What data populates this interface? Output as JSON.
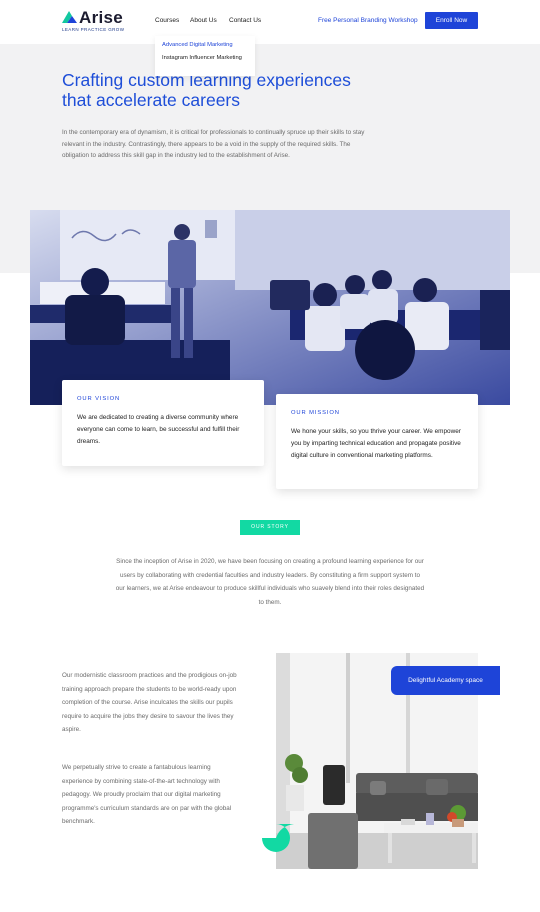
{
  "header": {
    "logo_word": "Arise",
    "logo_tagline": "LEARN PRACTICE GROW",
    "nav": [
      "Courses",
      "About Us",
      "Contact Us"
    ],
    "workshop_link": "Free Personal Branding Workshop",
    "enroll_label": "Enroll Now"
  },
  "dropdown": {
    "items": [
      "Advanced Digital Marketing",
      "Instagram Influencer Marketing"
    ]
  },
  "hero": {
    "title": "Crafting custom learning experiences that accelerate careers",
    "text": "In the contemporary era of dynamism, it is critical for professionals to continually spruce up their skills to stay relevant in the industry. Contrastingly, there appears to be a void in the supply of the required skills. The obligation to address this skill gap in the industry led to the establishment of Arise."
  },
  "vision": {
    "label": "OUR VISION",
    "text": "We are dedicated to creating a diverse community where everyone can come to learn, be successful and fulfill their dreams."
  },
  "mission": {
    "label": "OUR MISSION",
    "text": "We hone your skills, so you thrive your career. We empower you by imparting technical education and propagate positive digital culture in conventional marketing platforms."
  },
  "story": {
    "badge": "OUR STORY",
    "text": "Since the inception of Arise in 2020, we have been focusing on creating a profound learning experience for our users by collaborating with credential faculties and industry leaders. By constituting a firm support system to our learners, we at Arise endeavour to produce skillful individuals who suavely blend into their roles designated to them."
  },
  "about": {
    "para1": "Our modernistic classroom practices and the prodigious on-job training approach prepare the students to be world-ready upon completion of the course. Arise inculcates the skills our pupils require to acquire the jobs they desire to savour the lives they aspire.",
    "para2": "We perpetually strive to create a fantabulous learning experience by combining state-of-the-art technology with pedagogy. We proudly proclaim that our digital marketing programme's curriculum standards are on par with the global benchmark.",
    "academy_badge": "Delightful Academy space"
  },
  "colors": {
    "brand_blue": "#1e44d8",
    "teal": "#12d9a3",
    "hero_bg": "#f2f2f3"
  }
}
